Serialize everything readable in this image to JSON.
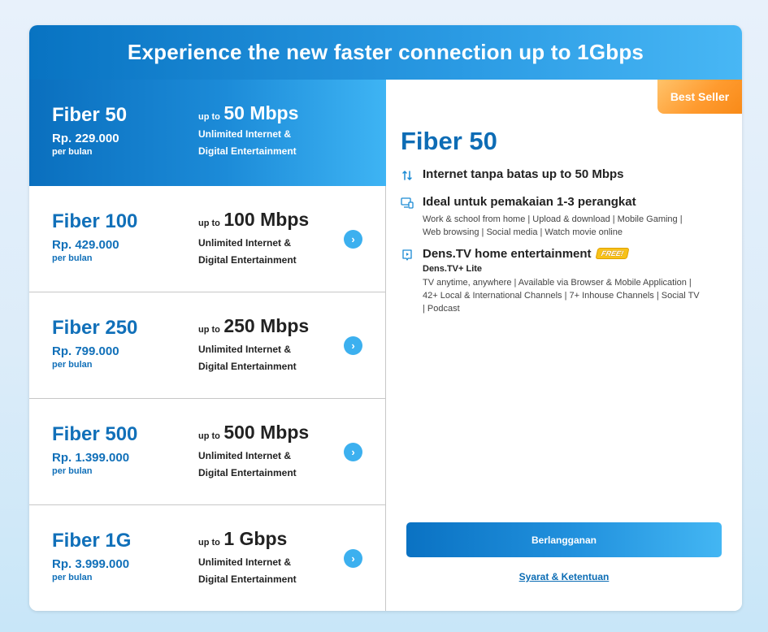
{
  "header": {
    "title": "Experience the new faster connection up to 1Gbps"
  },
  "plans": [
    {
      "name": "Fiber 50",
      "price": "Rp. 229.000",
      "period": "per bulan",
      "upto": "up to",
      "speed": "50 Mbps",
      "desc": "Unlimited Internet & Digital Entertainment",
      "selected": true
    },
    {
      "name": "Fiber 100",
      "price": "Rp. 429.000",
      "period": "per bulan",
      "upto": "up to",
      "speed": "100 Mbps",
      "desc": "Unlimited Internet & Digital Entertainment",
      "selected": false
    },
    {
      "name": "Fiber 250",
      "price": "Rp. 799.000",
      "period": "per bulan",
      "upto": "up to",
      "speed": "250 Mbps",
      "desc": "Unlimited Internet & Digital Entertainment",
      "selected": false
    },
    {
      "name": "Fiber 500",
      "price": "Rp. 1.399.000",
      "period": "per bulan",
      "upto": "up to",
      "speed": "500 Mbps",
      "desc": "Unlimited Internet & Digital Entertainment",
      "selected": false
    },
    {
      "name": "Fiber 1G",
      "price": "Rp. 3.999.000",
      "period": "per bulan",
      "upto": "up to",
      "speed": "1 Gbps",
      "desc": "Unlimited Internet & Digital Entertainment",
      "selected": false
    }
  ],
  "detail": {
    "badge": "Best Seller",
    "title": "Fiber 50",
    "features": {
      "internet": {
        "icon": "speed-arrows-icon",
        "title": "Internet tanpa batas up to 50 Mbps"
      },
      "devices": {
        "icon": "devices-icon",
        "title": "Ideal untuk pemakaian 1-3 perangkat",
        "text": "Work & school from home | Upload & download | Mobile Gaming | Web browsing | Social media | Watch movie online"
      },
      "tv": {
        "icon": "tv-icon",
        "title": "Dens.TV home entertainment",
        "free_tag": "FREE!",
        "subtitle": "Dens.TV+ Lite",
        "text": "TV anytime, anywhere | Available via Browser & Mobile Application | 42+ Local & International Channels | 7+ Inhouse Channels | Social TV | Podcast"
      }
    },
    "subscribe_label": "Berlangganan",
    "terms_label": "Syarat & Ketentuan"
  },
  "colors": {
    "primary": "#0d6cb5",
    "accent": "#3cb0ef",
    "badge": "#ff9b2f"
  }
}
